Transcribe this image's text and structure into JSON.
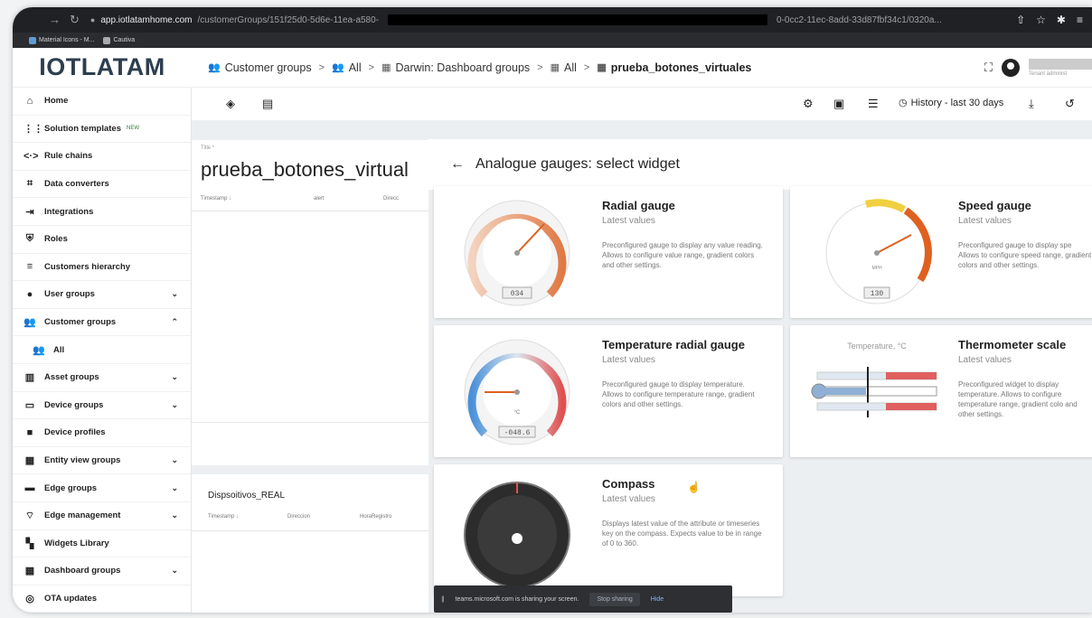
{
  "browser": {
    "host": "app.iotlatamhome.com",
    "path": "/customerGroups/151f25d0-5d6e-11ea-a580-",
    "url_tail": "0-0cc2-11ec-8add-33d87fbf34c1/0320a...",
    "bookmarks": [
      "Material Icons - M...",
      "Cautiva"
    ]
  },
  "app": {
    "logo": "IOTLATAM",
    "breadcrumbs": [
      "Customer groups",
      "All",
      "Darwin: Dashboard groups",
      "All",
      "prueba_botones_virtuales"
    ],
    "user_role": "Tenant administ"
  },
  "sidebar": {
    "items": [
      {
        "label": "Home",
        "icon": "home-icon"
      },
      {
        "label": "Solution templates",
        "icon": "apps-icon",
        "badge": "NEW"
      },
      {
        "label": "Rule chains",
        "icon": "code-icon"
      },
      {
        "label": "Data converters",
        "icon": "transform-icon"
      },
      {
        "label": "Integrations",
        "icon": "input-icon"
      },
      {
        "label": "Roles",
        "icon": "shield-icon"
      },
      {
        "label": "Customers hierarchy",
        "icon": "sort-icon"
      },
      {
        "label": "User groups",
        "icon": "account-icon",
        "chevron": "down"
      },
      {
        "label": "Customer groups",
        "icon": "people-icon",
        "chevron": "up"
      },
      {
        "label": "All",
        "icon": "people-icon",
        "sub": true
      },
      {
        "label": "Asset groups",
        "icon": "domain-icon",
        "chevron": "down"
      },
      {
        "label": "Device groups",
        "icon": "devices-icon",
        "chevron": "down"
      },
      {
        "label": "Device profiles",
        "icon": "profile-icon"
      },
      {
        "label": "Entity view groups",
        "icon": "view-icon",
        "chevron": "down"
      },
      {
        "label": "Edge groups",
        "icon": "router-icon",
        "chevron": "down"
      },
      {
        "label": "Edge management",
        "icon": "antenna-icon",
        "chevron": "down"
      },
      {
        "label": "Widgets Library",
        "icon": "widgets-icon"
      },
      {
        "label": "Dashboard groups",
        "icon": "dashboard-icon",
        "chevron": "down"
      },
      {
        "label": "OTA updates",
        "icon": "update-icon"
      }
    ]
  },
  "dashboard": {
    "history_label": "History - last 30 days",
    "widget1": {
      "small_label": "Title *",
      "title": "prueba_botones_virtual",
      "columns": [
        "Timestamp ↓",
        "alert",
        "Direcc"
      ]
    },
    "widget2": {
      "title": "Dispsoitivos_REAL",
      "columns": [
        "Timestamp ↓",
        "Direccion",
        "HoraRegistro"
      ]
    }
  },
  "panel": {
    "title": "Analogue gauges: select widget",
    "widgets": [
      {
        "title": "Radial gauge",
        "subtitle": "Latest values",
        "desc": "Preconfigured gauge to display any value reading. Allows to configure value range, gradient colors and other settings.",
        "readout": "034"
      },
      {
        "title": "Speed gauge",
        "subtitle": "Latest values",
        "desc": "Preconfigured gauge to display spe Allows to configure speed range, gradient colors and other settings.",
        "readout": "130",
        "unit": "MPH"
      },
      {
        "title": "Temperature radial gauge",
        "subtitle": "Latest values",
        "desc": "Preconfigured gauge to display temperature. Allows to configure temperature range, gradient colors and other settings.",
        "readout": "-048.6",
        "unit": "°C"
      },
      {
        "title": "Thermometer scale",
        "subtitle": "Latest values",
        "desc": "Preconfigured widget to display temperature. Allows to configure temperature range, gradient colo and other settings.",
        "scale_title": "Temperature, °C"
      },
      {
        "title": "Compass",
        "subtitle": "Latest values",
        "desc": "Displays latest value of the attribute or timeseries key on the compass. Expects value to be in range of 0 to 360."
      }
    ]
  },
  "toast": {
    "text": "teams.microsoft.com is sharing your screen.",
    "stop_label": "Stop sharing",
    "hide_label": "Hide"
  }
}
